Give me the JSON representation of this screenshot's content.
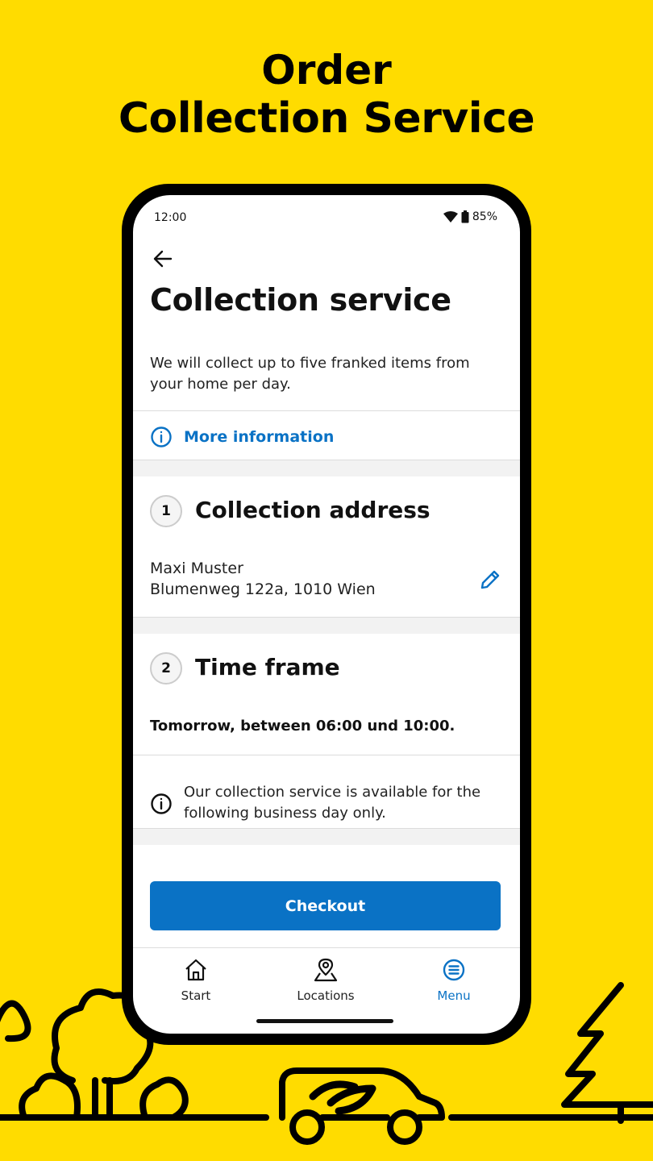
{
  "hero": {
    "line1": "Order",
    "line2": "Collection Service"
  },
  "status_bar": {
    "time": "12:00",
    "battery": "85%",
    "icons": [
      "wifi-icon",
      "battery-icon"
    ]
  },
  "header": {
    "back_icon": "arrow-left-icon",
    "title": "Collection service"
  },
  "intro": {
    "text": "We will collect up to five franked items from your home per day."
  },
  "more_info": {
    "icon": "info-circle-icon",
    "label": "More information"
  },
  "steps": [
    {
      "number": "1",
      "title": "Collection address"
    },
    {
      "number": "2",
      "title": "Time frame"
    }
  ],
  "address": {
    "name": "Maxi Muster",
    "street": "Blumenweg 122a, 1010 Wien",
    "edit_icon": "pencil-icon"
  },
  "time_frame": {
    "value": "Tomorrow, between 06:00 und 10:00.",
    "notice_icon": "info-circle-icon",
    "notice": "Our collection service is available for the following business day only."
  },
  "checkout": {
    "label": "Checkout"
  },
  "bottom_nav": [
    {
      "label": "Start",
      "icon": "home-icon",
      "active": false
    },
    {
      "label": "Locations",
      "icon": "map-pin-icon",
      "active": false
    },
    {
      "label": "Menu",
      "icon": "menu-icon",
      "active": true
    }
  ],
  "colors": {
    "background": "#FFDC00",
    "accent": "#0A72C5",
    "text": "#111111"
  }
}
